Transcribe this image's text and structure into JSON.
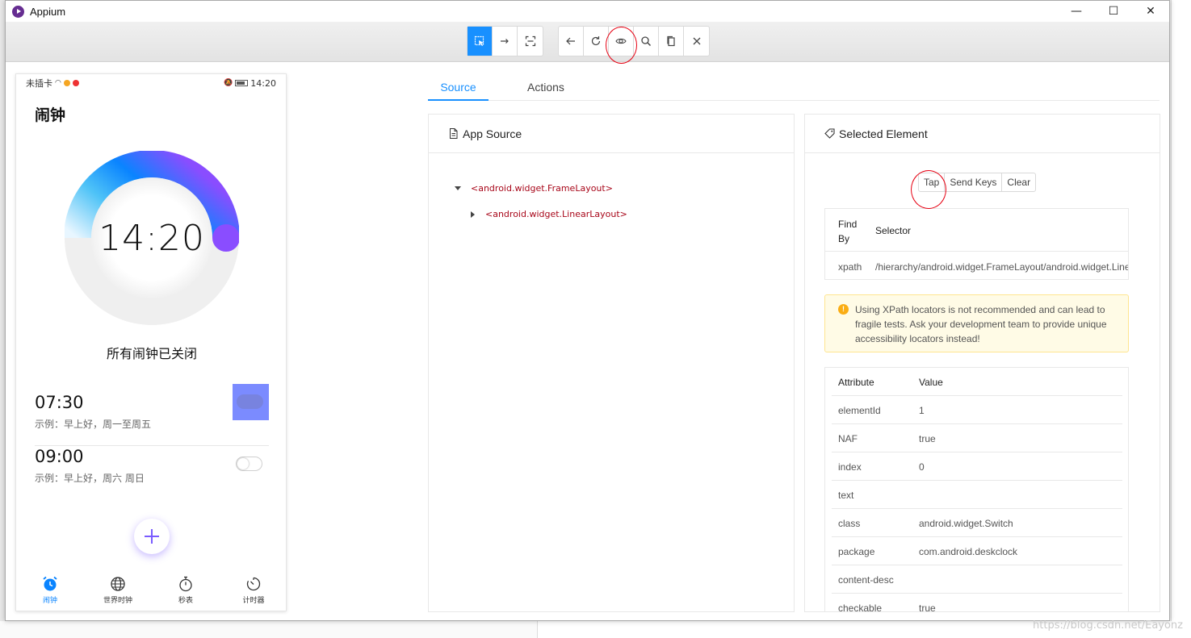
{
  "window": {
    "title": "Appium",
    "minimize": "—",
    "maximize": "☐",
    "close": "✕"
  },
  "toolbar": {
    "group1": [
      {
        "name": "select-elements",
        "icon": "select-icon"
      },
      {
        "name": "swipe",
        "icon": "arrow-right-icon"
      },
      {
        "name": "tap-by-coordinates",
        "icon": "fullscreen-icon"
      }
    ],
    "group2": [
      {
        "name": "back",
        "icon": "arrow-left-icon"
      },
      {
        "name": "refresh",
        "icon": "refresh-icon"
      },
      {
        "name": "toggle-visibility",
        "icon": "eye-icon"
      },
      {
        "name": "search",
        "icon": "search-icon"
      },
      {
        "name": "copy-xml",
        "icon": "copy-icon"
      },
      {
        "name": "quit-session",
        "icon": "close-icon"
      }
    ]
  },
  "phone": {
    "status_left": "未插卡",
    "status_time": "14:20",
    "page_title": "闹钟",
    "dial_time": "14:20",
    "all_off": "所有闹钟已关闭",
    "alarms": [
      {
        "time": "07:30",
        "desc": "示例：早上好，周一至周五"
      },
      {
        "time": "09:00",
        "desc": "示例：早上好，周六 周日"
      }
    ],
    "nav": [
      {
        "label": "闹钟",
        "icon": "alarm-clock-icon",
        "active": true
      },
      {
        "label": "世界时钟",
        "icon": "globe-icon",
        "active": false
      },
      {
        "label": "秒表",
        "icon": "stopwatch-icon",
        "active": false
      },
      {
        "label": "计时器",
        "icon": "timer-icon",
        "active": false
      }
    ],
    "accent": "#0a84ff",
    "dial_gradient": [
      "#4fc3f7",
      "#0a84ff",
      "#8a4dff"
    ]
  },
  "tabs": {
    "source": "Source",
    "actions": "Actions"
  },
  "source_panel": {
    "title": "App Source",
    "tree": [
      {
        "label": "<android.widget.FrameLayout>",
        "expanded": true
      },
      {
        "label": "<android.widget.LinearLayout>",
        "expanded": false
      }
    ]
  },
  "selected_panel": {
    "title": "Selected Element",
    "buttons": {
      "tap": "Tap",
      "send_keys": "Send Keys",
      "clear": "Clear"
    },
    "selector_table": {
      "col_find_by": "Find By",
      "col_selector": "Selector",
      "row_find_by": "xpath",
      "row_selector": "/hierarchy/android.widget.FrameLayout/android.widget.LinearLayout"
    },
    "warning": "Using XPath locators is not recommended and can lead to fragile tests. Ask your development team to provide unique accessibility locators instead!",
    "attr_table": {
      "col_attribute": "Attribute",
      "col_value": "Value",
      "rows": [
        {
          "attr": "elementId",
          "value": "1"
        },
        {
          "attr": "NAF",
          "value": "true"
        },
        {
          "attr": "index",
          "value": "0"
        },
        {
          "attr": "text",
          "value": ""
        },
        {
          "attr": "class",
          "value": "android.widget.Switch"
        },
        {
          "attr": "package",
          "value": "com.android.deskclock"
        },
        {
          "attr": "content-desc",
          "value": ""
        },
        {
          "attr": "checkable",
          "value": "true"
        }
      ]
    }
  },
  "watermark": "https://blog.csdn.net/Eayonz",
  "colors": {
    "primary": "#1890ff",
    "warning_bg": "#fffbe6",
    "annotation": "#e60012"
  }
}
